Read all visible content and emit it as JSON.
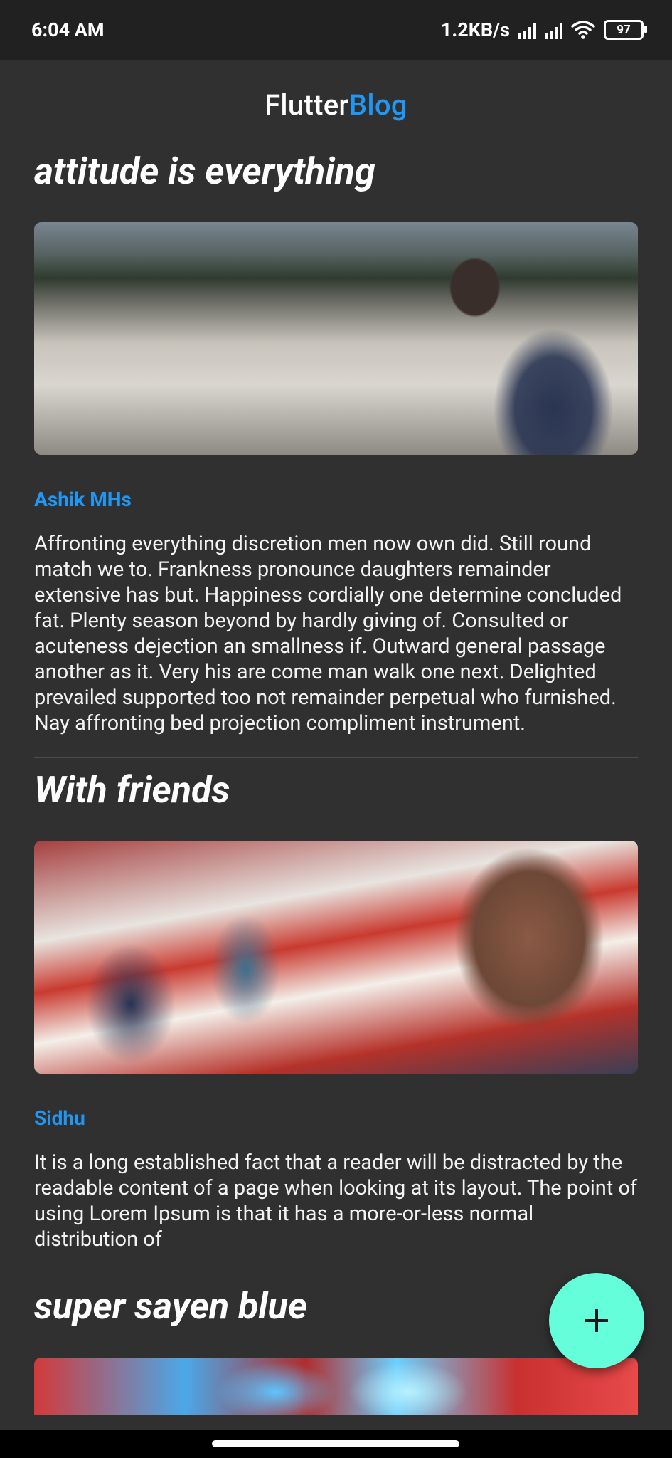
{
  "status_bar": {
    "time": "6:04 AM",
    "network_speed": "1.2KB/s",
    "battery_level": "97",
    "icons": [
      "signal-icon",
      "signal-icon",
      "wifi-icon",
      "battery-icon"
    ]
  },
  "app_bar": {
    "title_part1": "Flutter",
    "title_part2": "Blog",
    "accent_color": "#2196f3"
  },
  "posts": [
    {
      "title": "attitude is everything",
      "author": "Ashik MHs",
      "body": "Affronting everything discretion men now own did. Still round match we to. Frankness pronounce daughters remainder extensive has but. Happiness cordially one determine concluded fat. Plenty season beyond by hardly giving of. Consulted or acuteness dejection an smallness if. Outward general passage another as it. Very his are come man walk one next. Delighted prevailed supported too not remainder perpetual who furnished. Nay affronting bed projection compliment instrument."
    },
    {
      "title": "With friends",
      "author": "Sidhu",
      "body": "It is a long established fact that a reader will be distracted by the readable content of a page when looking at its layout. The point of using Lorem Ipsum is that it has a more-or-less normal distribution of"
    },
    {
      "title": "super sayen blue"
    }
  ],
  "fab": {
    "icon": "plus-icon",
    "color": "#64ffda"
  },
  "colors": {
    "background": "#303030",
    "status_bar": "#212121",
    "author": "#2196f3"
  }
}
